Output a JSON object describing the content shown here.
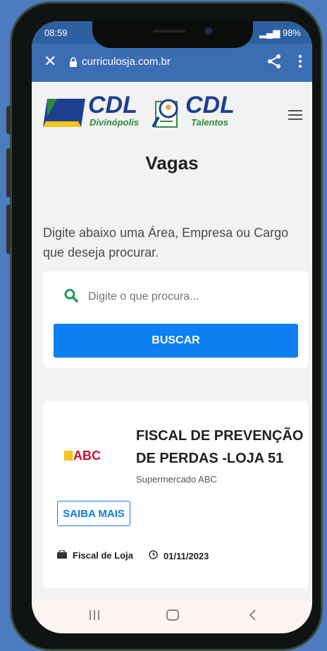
{
  "status": {
    "time": "08:59",
    "battery": "98%"
  },
  "browser": {
    "url": "curriculosja.com.br"
  },
  "header": {
    "logo1_main": "CDL",
    "logo1_sub": "Divinópolis",
    "logo2_main": "CDL",
    "logo2_sub": "Talentos"
  },
  "main": {
    "title": "Vagas",
    "description": "Digite abaixo uma Área, Empresa ou Cargo que deseja procurar.",
    "search_placeholder": "Digite o que procura...",
    "search_button": "BUSCAR"
  },
  "job": {
    "company_logo_text": "ABC",
    "title": "FISCAL DE PREVENÇÃO DE PERDAS -LOJA 51",
    "company": "Supermercado ABC",
    "button": "SAIBA MAIS",
    "role": "Fiscal de Loja",
    "date": "01/11/2023"
  },
  "colors": {
    "accent": "#0d7ff0",
    "browser_bar": "#3b6db3",
    "brand_blue": "#1d3f8f",
    "brand_green": "#2d8a3a"
  }
}
